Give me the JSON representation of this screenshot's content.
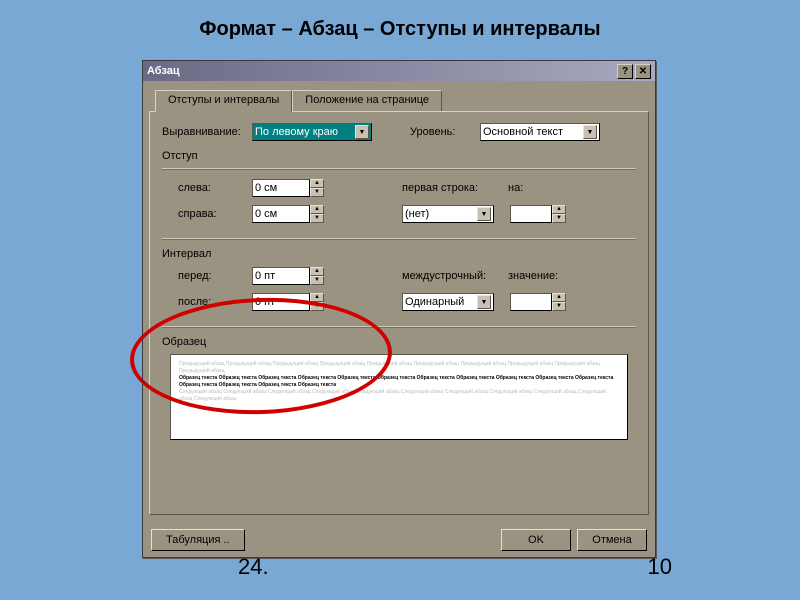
{
  "slide": {
    "title": "Формат – Абзац – Отступы и интервалы"
  },
  "footer": {
    "left": "24.",
    "right": "10"
  },
  "dialog": {
    "title": "Абзац",
    "help": "?",
    "close": "✕",
    "tabs": {
      "active": "Отступы и интервалы",
      "inactive": "Положение на странице"
    },
    "alignment": {
      "label": "Выравнивание:",
      "value": "По левому краю"
    },
    "level": {
      "label": "Уровень:",
      "value": "Основной текст"
    },
    "indent": {
      "group": "Отступ",
      "left_label": "слева:",
      "left_value": "0 см",
      "right_label": "справа:",
      "right_value": "0 см",
      "firstline_label": "первая строка:",
      "firstline_value": "(нет)",
      "by_label": "на:"
    },
    "spacing": {
      "group": "Интервал",
      "before_label": "перед:",
      "before_value": "0 пт",
      "after_label": "после:",
      "after_value": "0 пт",
      "line_label": "междустрочный:",
      "line_value": "Одинарный",
      "at_label": "значение:"
    },
    "preview_label": "Образец",
    "preview_text": {
      "light1": "Предыдущий абзац Предыдущий абзац Предыдущий абзац Предыдущий абзац Предыдущий абзац Предыдущий абзац Предыдущий абзац Предыдущий абзац Предыдущий абзац Предыдущий абзац",
      "dark": "Образец текста Образец текста Образец текста Образец текста Образец текста Образец текста Образец текста Образец текста Образец текста Образец текста Образец текста Образец текста Образец текста Образец текста Образец текста",
      "light2": "Следующий абзац Следующий абзац Следующий абзац Следующий абзац Следующий абзац Следующий абзац Следующий абзац Следующий абзац Следующий абзац Следующий абзац Следующий абзац"
    },
    "buttons": {
      "tabs": "Табуляция ..",
      "ok": "OK",
      "cancel": "Отмена"
    }
  }
}
